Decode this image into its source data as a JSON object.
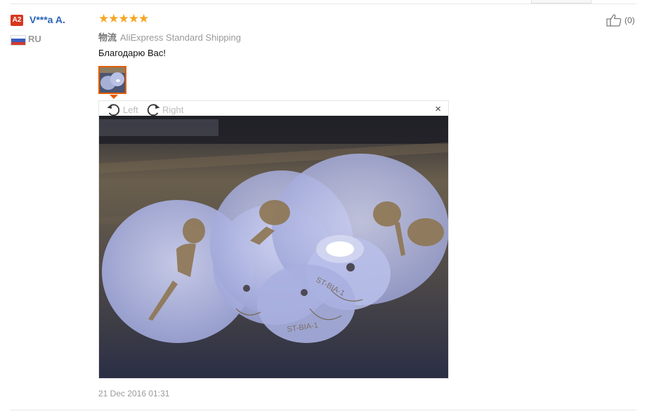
{
  "review": {
    "level_badge": "A2",
    "username": "V***a A.",
    "country": "RU",
    "rating_stars": "★★★★★",
    "rating_value": 5,
    "shipping_label": "物流",
    "shipping_method": "AliExpress Standard Shipping",
    "text": "Благодарю Вас!",
    "helpful_count": "(0)",
    "date": "21 Dec 2016 01:31"
  },
  "viewer": {
    "rotate_left_label": "Left",
    "rotate_right_label": "Right",
    "close_symbol": "×"
  },
  "icons": {
    "thumbs_up": "thumbs-up-icon",
    "rotate_left": "rotate-left-icon",
    "rotate_right": "rotate-right-icon",
    "close": "close-icon",
    "flag": "russia-flag-icon"
  },
  "colors": {
    "username": "#2a64b6",
    "badge": "#d7371f",
    "stars": "#f5a623",
    "thumb_border": "#e65c00"
  }
}
